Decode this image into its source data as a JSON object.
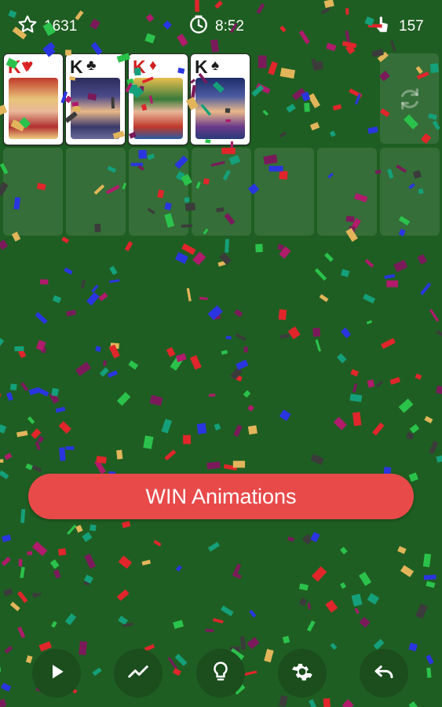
{
  "topbar": {
    "score": "1631",
    "time": "8:52",
    "moves": "157",
    "score_icon": "star-icon",
    "time_icon": "clock-icon",
    "moves_icon": "tap-hand-icon"
  },
  "foundations": [
    {
      "rank": "K",
      "suit": "♥",
      "color": "red"
    },
    {
      "rank": "K",
      "suit": "♣",
      "color": "black"
    },
    {
      "rank": "K",
      "suit": "♦",
      "color": "red"
    },
    {
      "rank": "K",
      "suit": "♠",
      "color": "black"
    }
  ],
  "stock": {
    "icon": "refresh-icon"
  },
  "win_button": {
    "label": "WIN Animations"
  },
  "bottom_bar": [
    {
      "name": "play-button",
      "icon": "play-icon"
    },
    {
      "name": "stats-button",
      "icon": "trend-icon"
    },
    {
      "name": "hint-button",
      "icon": "lightbulb-icon"
    },
    {
      "name": "settings-button",
      "icon": "gear-icon"
    },
    {
      "name": "undo-button",
      "icon": "undo-icon"
    }
  ],
  "colors": {
    "background": "#1f5e22",
    "button": "#e84a4a",
    "confetti": [
      "#e0262b",
      "#2a35e0",
      "#e2b55a",
      "#7a1a5a",
      "#14a07a",
      "#3b3b3b",
      "#2bc24b",
      "#b01b6b"
    ]
  }
}
